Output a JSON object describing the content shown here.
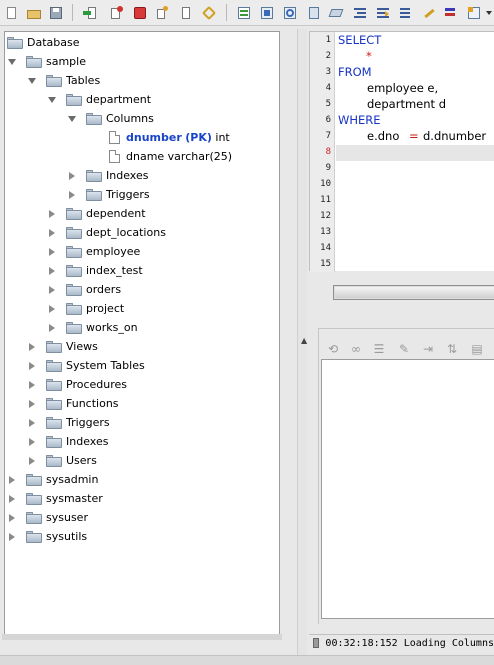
{
  "toolbar": {
    "buttons": [
      "new-icon",
      "open-icon",
      "save-icon",
      "import-icon",
      "disconnect-icon",
      "stop-icon",
      "refresh-icon",
      "copy-icon",
      "format-icon",
      "table-icon",
      "export-icon",
      "sync-icon",
      "notebook-icon",
      "layers-icon",
      "indent-icon",
      "align-icon",
      "edit-icon",
      "list-icon",
      "grid-icon"
    ]
  },
  "tree": {
    "root": "Database",
    "db": "sample",
    "tables": "Tables",
    "department": "department",
    "columns": "Columns",
    "col1_name": "dnumber",
    "col1_pk": "(PK)",
    "col1_type": "int",
    "col2": "dname varchar(25)",
    "indexes_sub": "Indexes",
    "triggers_sub": "Triggers",
    "other_tables": [
      "dependent",
      "dept_locations",
      "employee",
      "index_test",
      "orders",
      "project",
      "works_on"
    ],
    "sample_children": [
      "Views",
      "System Tables",
      "Procedures",
      "Functions",
      "Triggers",
      "Indexes",
      "Users"
    ],
    "other_dbs": [
      "sysadmin",
      "sysmaster",
      "sysuser",
      "sysutils"
    ]
  },
  "editor": {
    "line_numbers": [
      "1",
      "2",
      "3",
      "4",
      "5",
      "6",
      "7",
      "8",
      "9",
      "10",
      "11",
      "12",
      "13",
      "14",
      "15"
    ],
    "current_line": "8",
    "l1": "SELECT",
    "l2": "*",
    "l3": "FROM",
    "l4": "employee e,",
    "l5": "department d",
    "l6": "WHERE",
    "l7a": "e.dno",
    "l7b": "=",
    "l7c": "d.dnumber"
  },
  "results_toolbar": [
    "link-icon",
    "link2-icon",
    "list-icon",
    "edit-icon",
    "move-icon",
    "arrows-icon",
    "db-icon"
  ],
  "status": {
    "text": "00:32:18:152 Loading Columns"
  }
}
